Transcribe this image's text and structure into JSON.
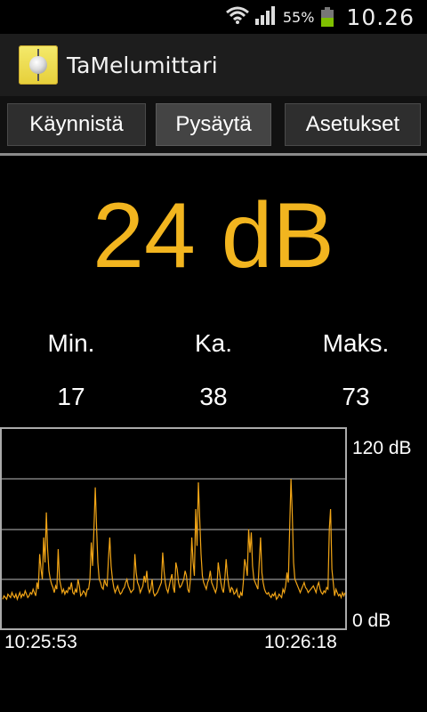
{
  "status_bar": {
    "battery_percent_text": "55%",
    "battery_level": 0.55,
    "clock": "10.26",
    "icons": [
      "wifi-icon",
      "signal-icon",
      "battery-icon"
    ]
  },
  "app": {
    "title": "TaMelumittari",
    "icon": "app-icon"
  },
  "buttons": {
    "start": "Käynnistä",
    "stop": "Pysäytä",
    "settings": "Asetukset"
  },
  "reading": {
    "value": "24 dB",
    "color": "#f2b51f"
  },
  "stats": {
    "min_label": "Min.",
    "avg_label": "Ka.",
    "max_label": "Maks.",
    "min_value": "17",
    "avg_value": "38",
    "max_value": "73"
  },
  "graph": {
    "y_max_label": "120 dB",
    "y_min_label": "0 dB",
    "start_time": "10:25:53",
    "end_time": "10:26:18",
    "line_color": "#f2a516"
  },
  "chart_data": {
    "type": "line",
    "ylim": [
      0,
      120
    ],
    "x_range": [
      "10:25:53",
      "10:26:18"
    ],
    "grid": true,
    "series": [
      {
        "values": [
          18,
          20,
          19,
          18,
          21,
          20,
          19,
          22,
          20,
          19,
          21,
          18,
          20,
          22,
          19,
          21,
          20,
          23,
          21,
          19,
          20,
          22,
          21,
          24,
          22,
          20,
          28,
          24,
          45,
          36,
          30,
          55,
          40,
          70,
          48,
          35,
          30,
          27,
          25,
          22,
          26,
          24,
          48,
          30,
          26,
          22,
          24,
          21,
          23,
          22,
          25,
          24,
          28,
          22,
          21,
          24,
          22,
          30,
          26,
          20,
          21,
          23,
          22,
          20,
          24,
          24,
          30,
          52,
          38,
          60,
          85,
          62,
          40,
          30,
          28,
          25,
          24,
          30,
          27,
          26,
          42,
          55,
          38,
          30,
          25,
          22,
          24,
          26,
          23,
          21,
          22,
          24,
          25,
          28,
          30,
          26,
          24,
          22,
          23,
          24,
          45,
          34,
          28,
          26,
          22,
          24,
          26,
          32,
          28,
          35,
          25,
          22,
          24,
          30,
          22,
          20,
          21,
          22,
          24,
          26,
          28,
          46,
          35,
          28,
          24,
          22,
          26,
          30,
          33,
          25,
          22,
          40,
          36,
          28,
          25,
          26,
          28,
          30,
          35,
          32,
          24,
          22,
          30,
          55,
          40,
          32,
          72,
          50,
          88,
          66,
          45,
          32,
          28,
          26,
          24,
          28,
          30,
          35,
          28,
          26,
          24,
          22,
          25,
          40,
          34,
          28,
          24,
          22,
          30,
          42,
          32,
          26,
          22,
          25,
          24,
          21,
          22,
          24,
          20,
          19,
          22,
          20,
          28,
          42,
          38,
          32,
          60,
          46,
          58,
          38,
          30,
          28,
          26,
          24,
          40,
          55,
          34,
          28,
          24,
          22,
          21,
          22,
          20,
          19,
          21,
          20,
          22,
          18,
          19,
          21,
          20,
          19,
          24,
          22,
          26,
          34,
          28,
          60,
          90,
          70,
          40,
          30,
          28,
          26,
          24,
          22,
          24,
          26,
          28,
          25,
          24,
          22,
          23,
          24,
          25,
          26,
          24,
          22,
          26,
          28,
          24,
          22,
          21,
          23,
          22,
          25,
          24,
          60,
          72,
          36,
          28,
          20,
          24,
          22,
          20,
          21,
          19,
          22,
          20,
          22
        ]
      }
    ]
  }
}
